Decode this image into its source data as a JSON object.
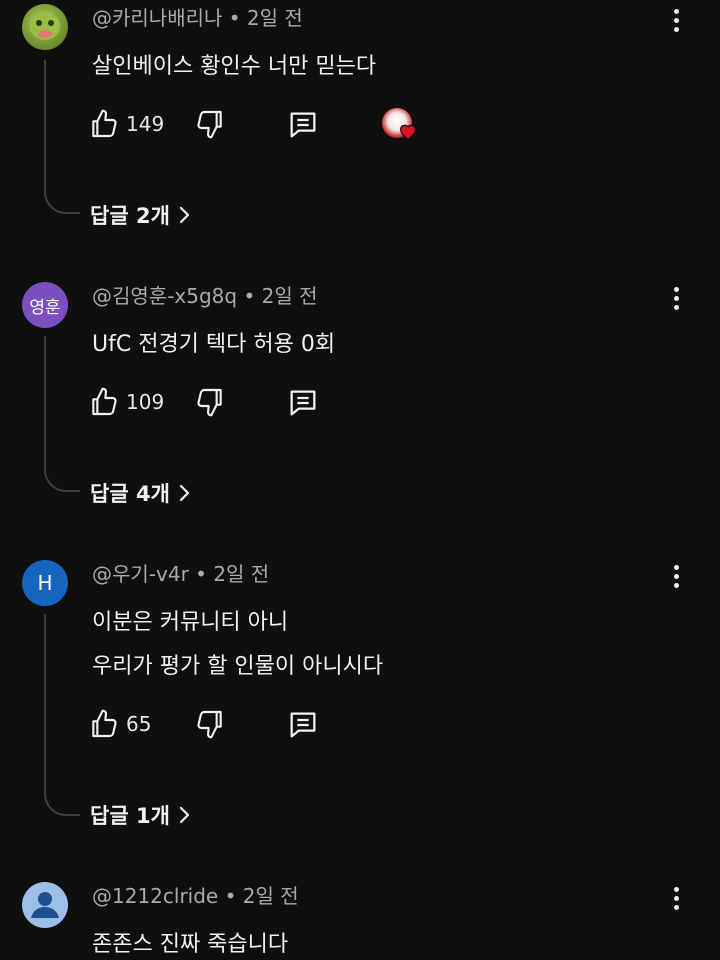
{
  "icons": {
    "like": "thumbs-up-icon",
    "dislike": "thumbs-down-icon",
    "reply": "comment-icon",
    "more": "more-vertical-icon",
    "chevron": "chevron-right-icon"
  },
  "comments": [
    {
      "author": "@카리나배리나",
      "time": "2일 전",
      "lines": [
        "살인베이스 황인수 너만 믿는다"
      ],
      "likes": "149",
      "creator_heart": true,
      "replies": "답글 2개",
      "avatar_text": ""
    },
    {
      "author": "@김영훈-x5g8q",
      "time": "2일 전",
      "lines": [
        "UfC 전경기 텍다 허용 0회"
      ],
      "likes": "109",
      "creator_heart": false,
      "replies": "답글 4개",
      "avatar_text": "영훈"
    },
    {
      "author": "@우기-v4r",
      "time": "2일 전",
      "lines": [
        "이분은 커뮤니티 아니",
        "우리가 평가 할 인물이 아니시다"
      ],
      "likes": "65",
      "creator_heart": false,
      "replies": "답글 1개",
      "avatar_text": "H"
    },
    {
      "author": "@1212clride",
      "time": "2일 전",
      "lines": [
        "존존스 진짜 죽습니다"
      ],
      "avatar_text": ""
    }
  ],
  "separator": " • ",
  "colors": {
    "background": "#0f0f0f",
    "text": "#f1f1f1",
    "meta": "#aaaaaa",
    "heart": "#e0102a"
  }
}
